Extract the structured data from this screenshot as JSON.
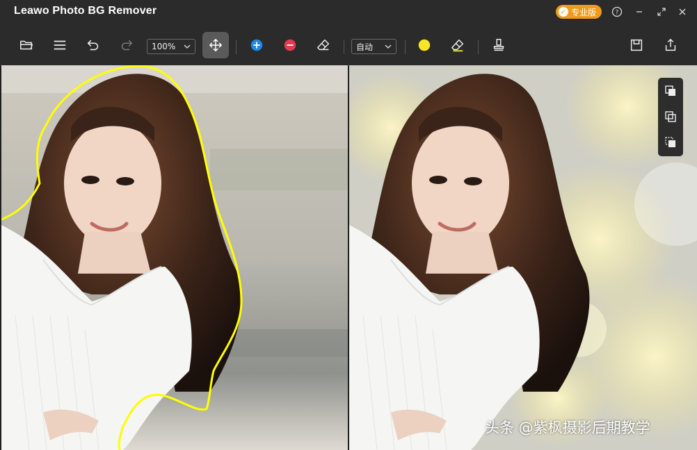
{
  "app": {
    "title": "Leawo Photo BG Remover"
  },
  "titlebar": {
    "pro_label": "专业版",
    "help_icon": "help-icon",
    "minimize_icon": "minimize-icon",
    "restore_icon": "restore-icon",
    "close_icon": "close-icon"
  },
  "toolbar": {
    "zoom": {
      "value": "100%"
    },
    "mode": {
      "value": "自动"
    },
    "brush_color": "#f6e52a",
    "add_color": "#1e88e5",
    "remove_color": "#e53950"
  },
  "watermark": "头条 @紫枫摄影后期教学",
  "colors": {
    "accent": "#f29a1a",
    "outline": "#ffff00",
    "background": "#2b2b2b"
  }
}
